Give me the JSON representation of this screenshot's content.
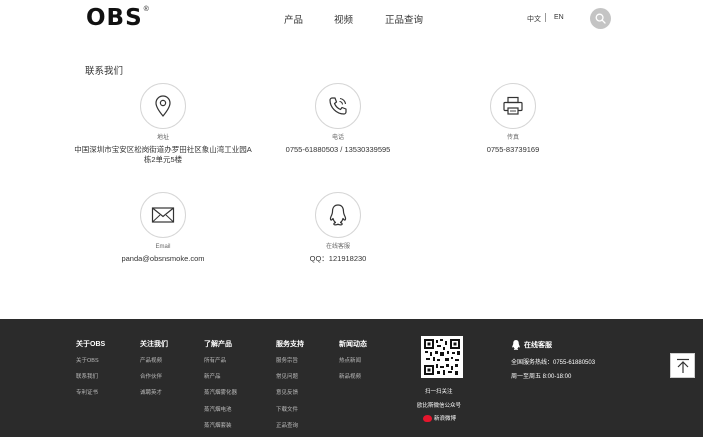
{
  "header": {
    "logo_text": "OBS",
    "logo_reg": "®",
    "nav": [
      "产品",
      "视频",
      "正品查询"
    ],
    "lang_cn": "中文",
    "lang_en": "EN",
    "search_icon": "search-icon"
  },
  "contact": {
    "title": "联系我们",
    "items": [
      {
        "icon": "location-pin-icon",
        "label": "地址",
        "value": "中国深圳市宝安区松岗街道办罗田社区象山湾工业园A栋2单元5楼"
      },
      {
        "icon": "phone-icon",
        "label": "电话",
        "value": "0755-61880503 / 13530339595"
      },
      {
        "icon": "fax-icon",
        "label": "传真",
        "value": "0755-83739169"
      },
      {
        "icon": "mail-icon",
        "label": "Email",
        "value": "panda@obsnsmoke.com"
      },
      {
        "icon": "qq-icon",
        "label": "在线客服",
        "value": "QQ：121918230"
      }
    ]
  },
  "footer": {
    "columns": [
      {
        "title": "关于OBS",
        "links": [
          "关于OBS",
          "联系我们",
          "专利证书"
        ]
      },
      {
        "title": "关注我们",
        "links": [
          "产品视频",
          "合作伙伴",
          "诚聘英才"
        ]
      },
      {
        "title": "了解产品",
        "links": [
          "所有产品",
          "新产品",
          "蒸汽烟雾化器",
          "蒸汽烟电池",
          "蒸汽烟套装"
        ]
      },
      {
        "title": "服务支持",
        "links": [
          "服务宗旨",
          "常见问题",
          "意见反馈",
          "下载文件",
          "正品查询"
        ]
      },
      {
        "title": "新闻动态",
        "links": [
          "热点新闻",
          "新品视频"
        ]
      }
    ],
    "qr_caption_1": "扫一扫关注",
    "qr_caption_2": "欧比斯微信公众号",
    "weibo": "新浪微博",
    "service_title": "在线客服",
    "hotline": "全国服务热线：0755-61880503",
    "hours": "周一至周五 8:00-18:00",
    "top_icon": "arrow-up-icon"
  }
}
